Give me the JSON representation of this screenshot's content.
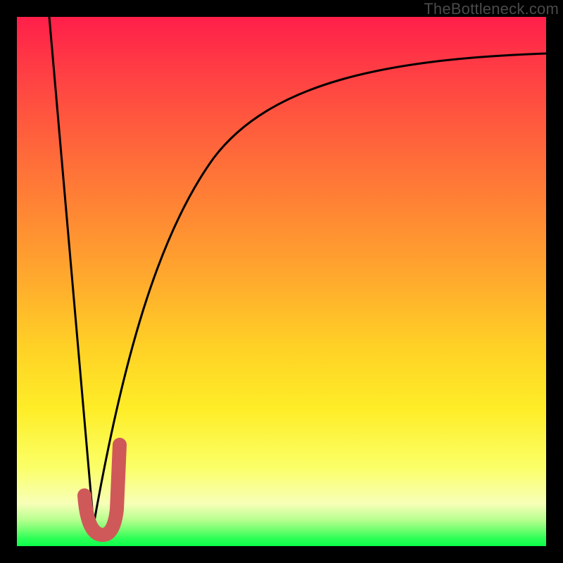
{
  "watermark": "TheBottleneck.com",
  "chart_data": {
    "type": "line",
    "title": "",
    "xlabel": "",
    "ylabel": "",
    "xlim": [
      0,
      100
    ],
    "ylim": [
      0,
      100
    ],
    "grid": false,
    "legend": false,
    "series": [
      {
        "name": "left-slope",
        "color": "#000000",
        "x": [
          6,
          14.5
        ],
        "values": [
          100,
          4
        ]
      },
      {
        "name": "right-curve",
        "color": "#000000",
        "x": [
          14.5,
          18,
          20,
          23,
          27,
          32,
          38,
          45,
          55,
          70,
          85,
          100
        ],
        "values": [
          4,
          24,
          35,
          47,
          58,
          67,
          74,
          80,
          85,
          89,
          91.5,
          93
        ]
      },
      {
        "name": "j-mark",
        "color": "#cf5959",
        "x": [
          13,
          14,
          15,
          16,
          17,
          18,
          19
        ],
        "values": [
          10,
          5,
          3,
          3,
          5,
          11,
          20
        ]
      }
    ],
    "gradient_stops": [
      {
        "pos": 0,
        "color": "#ff1f4a"
      },
      {
        "pos": 50,
        "color": "#ffab2d"
      },
      {
        "pos": 85,
        "color": "#fbff66"
      },
      {
        "pos": 100,
        "color": "#0bff4a"
      }
    ]
  }
}
